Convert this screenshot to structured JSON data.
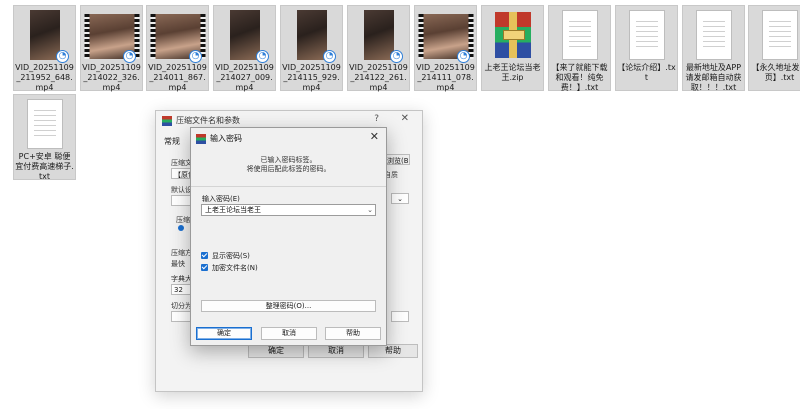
{
  "files": [
    {
      "name": "VID_20251109_211952_648.mp4",
      "kind": "video"
    },
    {
      "name": "VID_20251109_214022_326.mp4",
      "kind": "video-wide"
    },
    {
      "name": "VID_20251109_214011_867.mp4",
      "kind": "video-wide"
    },
    {
      "name": "VID_20251109_214027_009.mp4",
      "kind": "video"
    },
    {
      "name": "VID_20251109_214115_929.mp4",
      "kind": "video"
    },
    {
      "name": "VID_20251109_214122_261.mp4",
      "kind": "video"
    },
    {
      "name": "VID_20251109_214111_078.mp4",
      "kind": "video-wide"
    },
    {
      "name": "上老王论坛当老王.zip",
      "kind": "zip"
    },
    {
      "name": "【来了就能下载和观看！纯免费！】.txt",
      "kind": "text"
    },
    {
      "name": "【论坛介绍】.txt",
      "kind": "text"
    },
    {
      "name": "最新地址及APP请发邮箱自动获取！！！.txt",
      "kind": "text"
    },
    {
      "name": "【永久地址发布页】.txt",
      "kind": "text"
    },
    {
      "name": "PC+安卓 聪便宜付费高速梯子.txt",
      "kind": "text"
    }
  ],
  "archive_dialog": {
    "title": "压缩文件名和参数",
    "help": "?",
    "tab": "常规",
    "labels": [
      "压缩文",
      "【原包",
      "默认设置",
      "压缩文",
      "压缩方",
      "最快",
      "字典大小",
      "32",
      "切分为"
    ],
    "browse": "浏览(B)...",
    "side_text": "自质",
    "ok": "确定",
    "cancel": "取消",
    "help_button": "帮助"
  },
  "password_dialog": {
    "title": "输入密码",
    "close": "✕",
    "info_line1": "已输入密码标签。",
    "info_line2": "将使用后配此标签的密码。",
    "password_label": "输入密码(E)",
    "password_value": "上老王论坛当老王",
    "show_password": "显示密码(S)",
    "encrypt_names": "加密文件名(N)",
    "manage": "整理密码(O)...",
    "ok": "确定",
    "cancel": "取消",
    "help": "帮助"
  }
}
